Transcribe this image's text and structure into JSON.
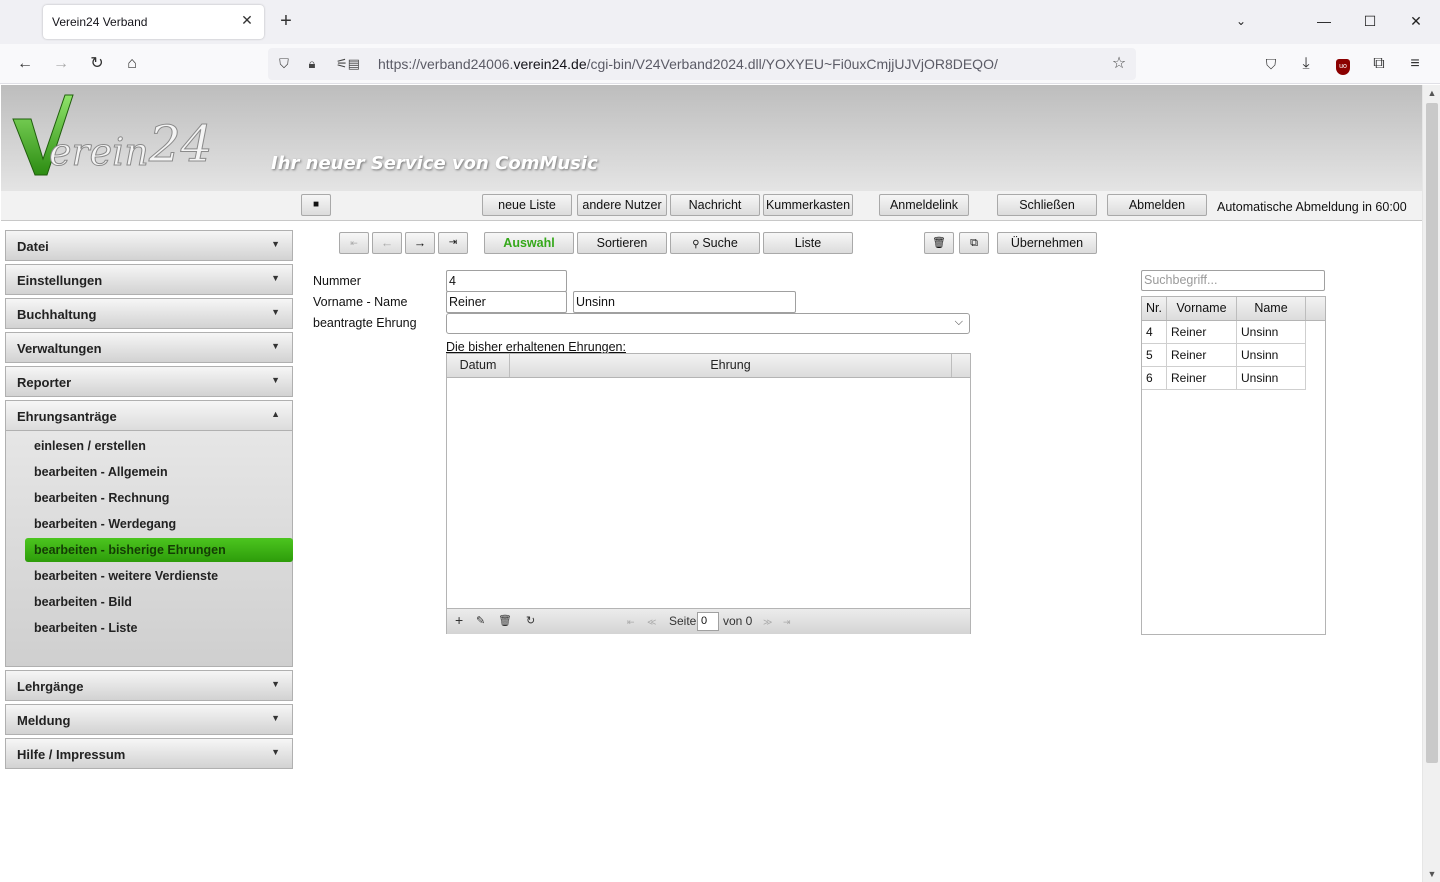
{
  "browser": {
    "tab_title": "Verein24 Verband",
    "url_prefix": "https://verband24006.",
    "url_domain": "verein24.de",
    "url_path": "/cgi-bin/V24Verband2024.dll/YOXYEU~Fi0uxCmjjUJVjOR8DEQO/"
  },
  "header": {
    "logo_text": "Verein 24",
    "slogan": "Ihr neuer Service von ComMusic"
  },
  "toolbar": {
    "neue_liste": "neue Liste",
    "andere_nutzer": "andere Nutzer",
    "nachricht": "Nachricht",
    "kummerkasten": "Kummerkasten",
    "anmeldelink": "Anmeldelink",
    "schliessen": "Schließen",
    "abmelden": "Abmelden",
    "auto_logout": "Automatische Abmeldung in 60:00"
  },
  "sidebar": {
    "datei": "Datei",
    "einstellungen": "Einstellungen",
    "buchhaltung": "Buchhaltung",
    "verwaltungen": "Verwaltungen",
    "reporter": "Reporter",
    "ehrungsantraege": "Ehrungsanträge",
    "sub": [
      "einlesen / erstellen",
      "bearbeiten - Allgemein",
      "bearbeiten - Rechnung",
      "bearbeiten - Werdegang",
      "bearbeiten - bisherige Ehrungen",
      "bearbeiten - weitere Verdienste",
      "bearbeiten - Bild",
      "bearbeiten - Liste"
    ],
    "lehrgaenge": "Lehrgänge",
    "meldung": "Meldung",
    "hilfe": "Hilfe / Impressum"
  },
  "record": {
    "auswahl": "Auswahl",
    "sortieren": "Sortieren",
    "suche": "Suche",
    "liste": "Liste",
    "uebernehmen": "Übernehmen"
  },
  "form": {
    "nummer_label": "Nummer",
    "nummer_value": "4",
    "name_label": "Vorname - Name",
    "vorname_value": "Reiner",
    "name_value": "Unsinn",
    "ehrung_label": "beantragte Ehrung",
    "ehrung_value": "",
    "section_title": "Die bisher erhaltenen Ehrungen:"
  },
  "ehrungen_grid": {
    "col_datum": "Datum",
    "col_ehrung": "Ehrung",
    "seite_label": "Seite",
    "seite_value": "0",
    "von_label": "von 0"
  },
  "search": {
    "placeholder": "Suchbegriff...",
    "col_nr": "Nr.",
    "col_vorname": "Vorname",
    "col_name": "Name",
    "rows": [
      {
        "nr": "4",
        "vorname": "Reiner",
        "name": "Unsinn"
      },
      {
        "nr": "5",
        "vorname": "Reiner",
        "name": "Unsinn"
      },
      {
        "nr": "6",
        "vorname": "Reiner",
        "name": "Unsinn"
      }
    ]
  }
}
